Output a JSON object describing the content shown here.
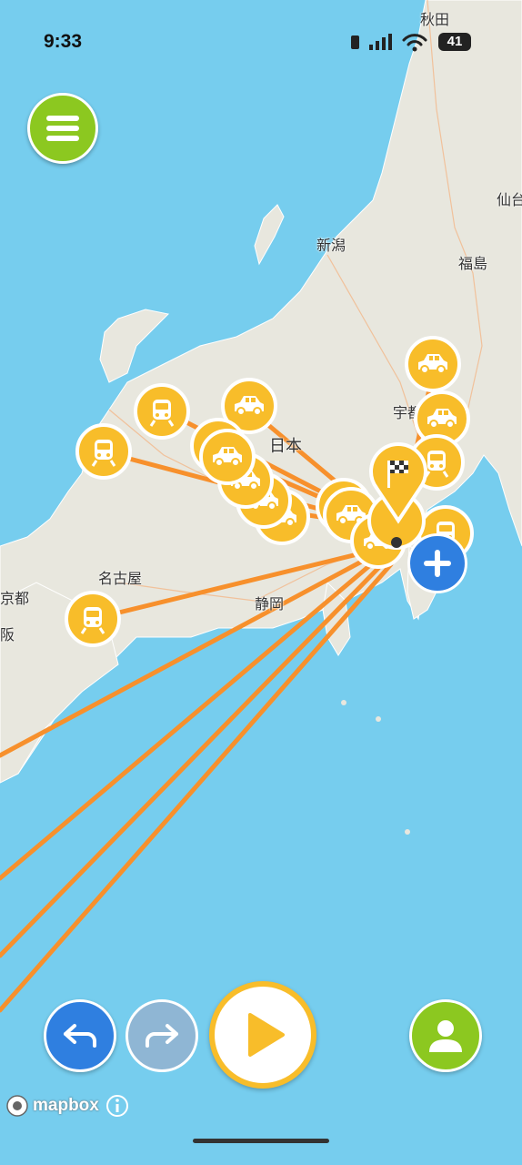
{
  "status_bar": {
    "time": "9:33",
    "battery": "41"
  },
  "map": {
    "place_labels": [
      "秋田",
      "仙台",
      "新潟",
      "福島",
      "宇都",
      "日本",
      "名古屋",
      "静岡",
      "京都",
      "阪"
    ],
    "attribution": "mapbox",
    "route_color": "#f7902c",
    "marker_color": "#f8bd2a",
    "water_color": "#76cdee",
    "land_color": "#e8e7de"
  },
  "markers": {
    "train_icon": "train-icon",
    "car_icon": "car-icon",
    "destination_icon": "checkered-flag-icon"
  },
  "controls": {
    "menu_icon": "hamburger-icon",
    "add_icon": "plus-icon",
    "undo_icon": "undo-arrow-icon",
    "redo_icon": "redo-arrow-icon",
    "play_icon": "play-icon",
    "profile_icon": "user-icon",
    "menu_color": "#8cc820",
    "add_color": "#2f7fe0",
    "undo_color": "#2f7fe0",
    "redo_color": "#8fb6d4",
    "play_color": "#f8bd2a"
  }
}
